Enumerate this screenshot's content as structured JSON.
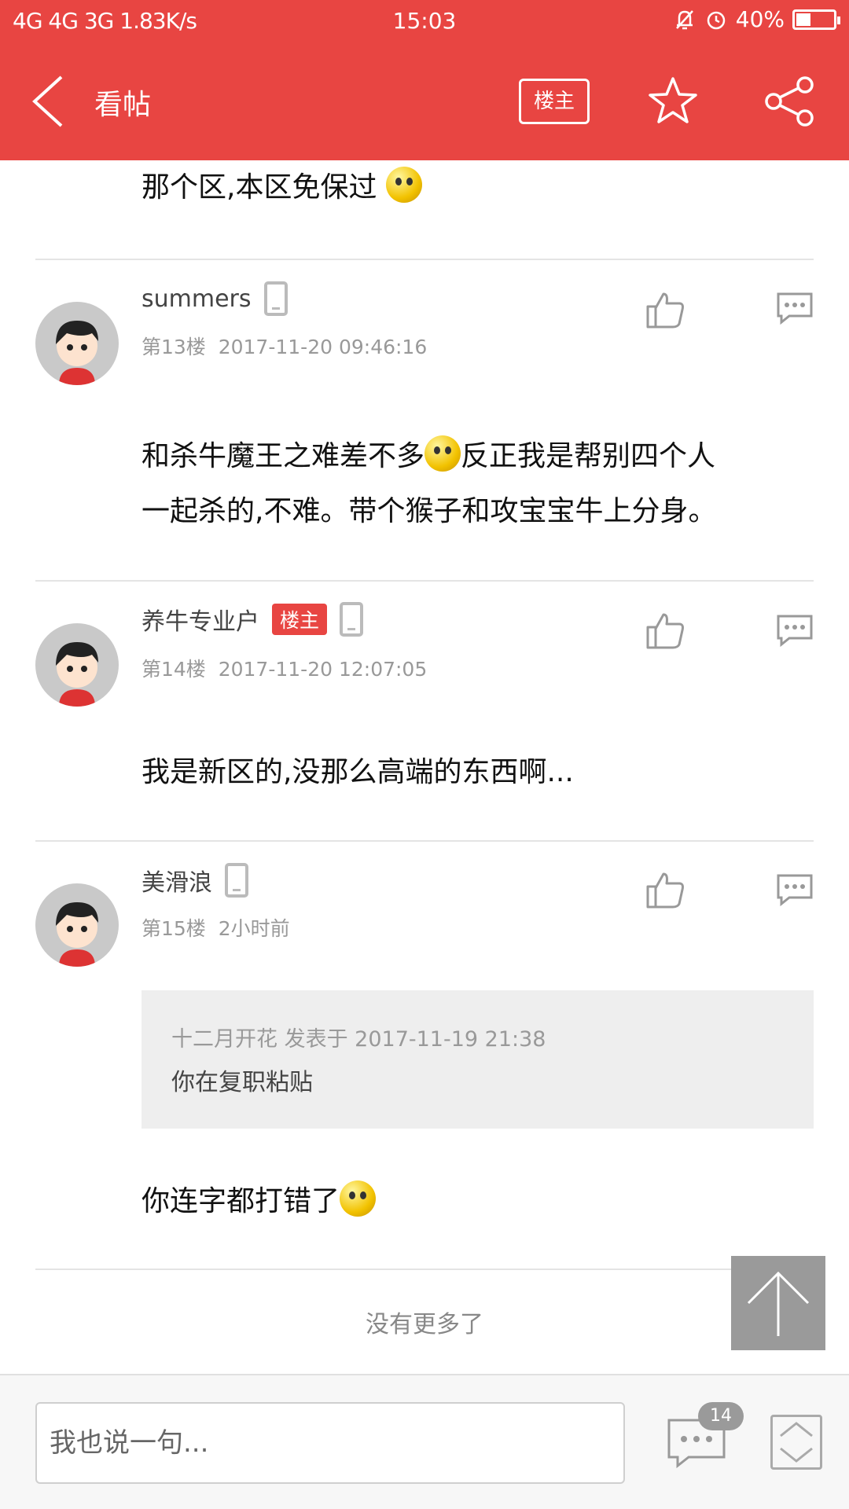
{
  "status_bar": {
    "signal": "4G 4G 3G",
    "speed": "1.83K/s",
    "time": "15:03",
    "battery": "40%",
    "battery_level": 0.4
  },
  "app_bar": {
    "title": "看帖",
    "op_filter": "楼主"
  },
  "previous_post_tail": "那个区,本区免保过",
  "posts": [
    {
      "username": "summers",
      "floor": "第13楼",
      "timestamp": "2017-11-20 09:46:16",
      "body_line1": "和杀牛魔王之难差不多",
      "body_line1b": "反正我是帮别四个人",
      "body_line2": "一起杀的,不难。带个猴子和攻宝宝牛上分身。"
    },
    {
      "username": "养牛专业户",
      "op_badge": "楼主",
      "floor": "第14楼",
      "timestamp": "2017-11-20 12:07:05",
      "body": "我是新区的,没那么高端的东西啊..."
    },
    {
      "username": "美滑浪",
      "floor": "第15楼",
      "timestamp": "2小时前",
      "quote_meta": "十二月开花 发表于 2017-11-19 21:38",
      "quote_text": "你在复职粘贴",
      "body": "你连字都打错了"
    }
  ],
  "no_more": "没有更多了",
  "bottom_bar": {
    "input_placeholder": "我也说一句...",
    "comment_count": "14"
  },
  "colors": {
    "accent": "#e84542",
    "divider": "#e4e4e4",
    "meta_text": "#999999"
  }
}
